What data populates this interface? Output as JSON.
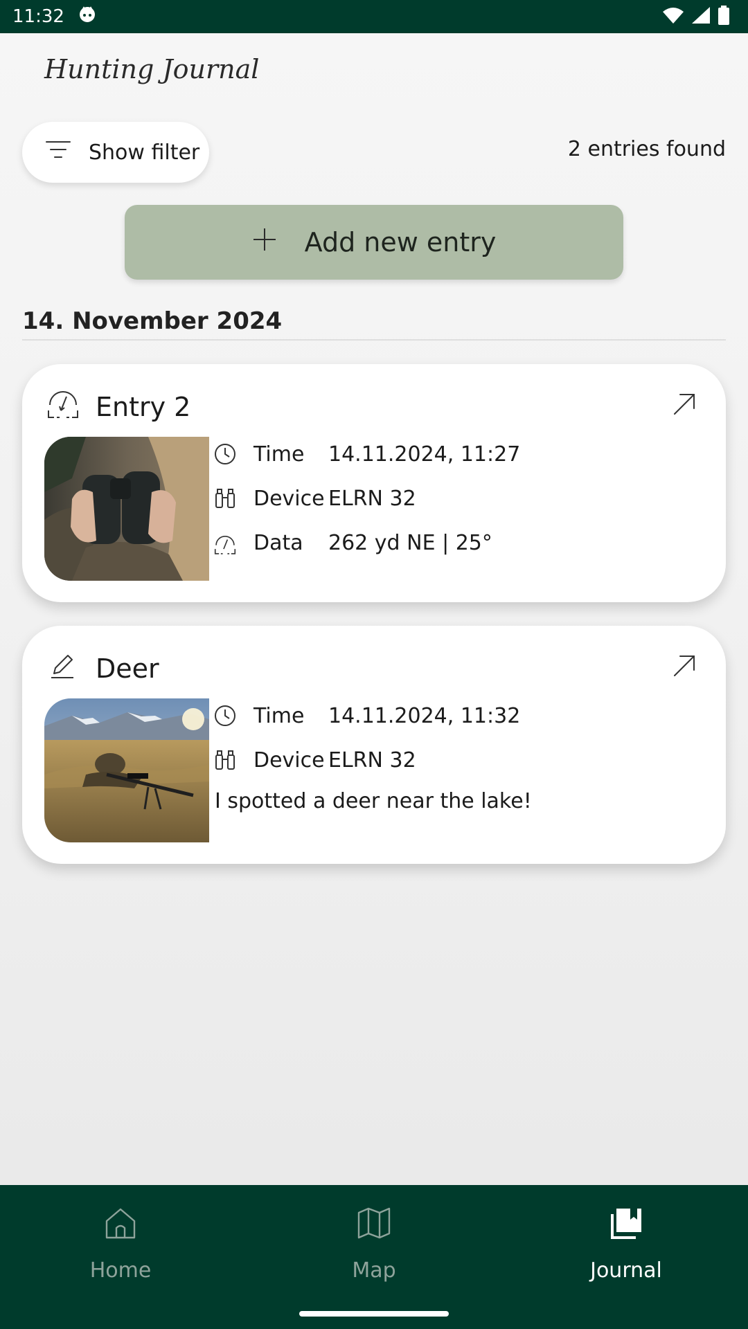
{
  "status_bar": {
    "time": "11:32",
    "icons": [
      "notification-face-icon",
      "wifi-icon",
      "signal-icon",
      "battery-icon"
    ]
  },
  "header": {
    "title": "Hunting Journal"
  },
  "filter": {
    "label": "Show filter",
    "icon": "filter-icon"
  },
  "results": {
    "count_label": "2 entries found"
  },
  "actions": {
    "add_label": "Add new entry",
    "add_icon": "plus-icon"
  },
  "section": {
    "date": "14. November 2024"
  },
  "entries": [
    {
      "title": "Entry 2",
      "title_icon": "rangefinder-icon",
      "image": "hunter-holding-binoculars",
      "rows": [
        {
          "icon": "clock-icon",
          "label": "Time",
          "value": "14.11.2024, 11:27"
        },
        {
          "icon": "binoculars-icon",
          "label": "Device",
          "value": "ELRN 32"
        },
        {
          "icon": "rangefinder-icon",
          "label": "Data",
          "value": "262 yd NE | 25°"
        }
      ]
    },
    {
      "title": "Deer",
      "title_icon": "pencil-icon",
      "image": "hunter-prone-with-rifle-in-meadow",
      "rows": [
        {
          "icon": "clock-icon",
          "label": "Time",
          "value": "14.11.2024, 11:32"
        },
        {
          "icon": "binoculars-icon",
          "label": "Device",
          "value": "ELRN 32"
        }
      ],
      "note": "I spotted a deer near the lake!"
    }
  ],
  "nav": {
    "items": [
      {
        "label": "Home",
        "icon": "home-icon",
        "active": false
      },
      {
        "label": "Map",
        "icon": "map-icon",
        "active": false
      },
      {
        "label": "Journal",
        "icon": "journal-icon",
        "active": true
      }
    ]
  },
  "colors": {
    "brand_dark_green": "#003b2c",
    "add_button_green": "#aebca6",
    "nav_inactive": "#8ea39b"
  }
}
